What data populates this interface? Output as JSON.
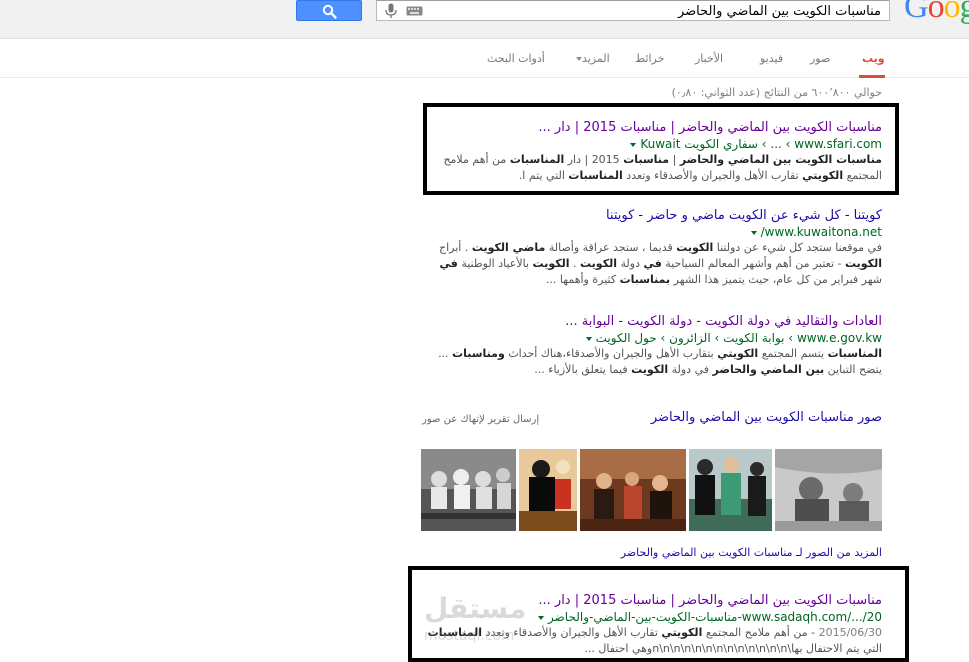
{
  "search": {
    "query": "مناسبات الكويت بين الماضي والحاضر",
    "logo_text": "Goog"
  },
  "tabs": [
    {
      "label": "ويب",
      "active": true
    },
    {
      "label": "صور"
    },
    {
      "label": "فيديو"
    },
    {
      "label": "الأخبار"
    },
    {
      "label": "خرائط"
    },
    {
      "label": "المزيد"
    },
    {
      "label": "أدوات البحث"
    }
  ],
  "stats": "حوالي ٦٠٠٬٨٠٠ من النتائج (عدد الثواني: ٠٫٨٠)",
  "results": [
    {
      "title": "مناسبات الكويت بين الماضي والحاضر | مناسبات 2015 | دار ...",
      "url": "www.sfari.com",
      "crumb": "› ... › سفاري الكويت Kuwait",
      "snippet": [
        {
          "b": "مناسبات الكويت بين الماضي والحاضر"
        },
        {
          "t": " | "
        },
        {
          "b": "مناسبات"
        },
        {
          "t": " 2015 | دار "
        },
        {
          "b": "المناسبات"
        },
        {
          "t": " من أهم ملامح المجتمع "
        },
        {
          "b": "الكويتي"
        },
        {
          "t": " تقارب الأهل والجيران والأصدقاء وتعدد "
        },
        {
          "b": "المناسبات"
        },
        {
          "t": " التي يتم ا."
        }
      ]
    },
    {
      "title": "كويتنا - كل شيء عن الكويت ماضي و حاضر - كويتنا",
      "url": "www.kuwaitona.net/",
      "snippet": [
        {
          "t": "في موقعنا ستجد كل شيء عن دولتنا "
        },
        {
          "b": "الكويت"
        },
        {
          "t": " قديما ، ستجد عراقة وأصالة "
        },
        {
          "b": "ماضي الكويت"
        },
        {
          "t": " . أبراج "
        },
        {
          "b": "الكويت"
        },
        {
          "t": " - تعتبر من أهم وأشهر المعالم السياحية "
        },
        {
          "b": "في"
        },
        {
          "t": " دولة "
        },
        {
          "b": "الكويت"
        },
        {
          "t": " . "
        },
        {
          "b": "الكويت"
        },
        {
          "t": " بالأعياد الوطنية "
        },
        {
          "b": "في"
        },
        {
          "t": " شهر فبراير من كل عام، حيث يتميز هذا الشهر "
        },
        {
          "b": "بمناسبات"
        },
        {
          "t": " كثيرة وأهمها ..."
        }
      ]
    },
    {
      "title": "العادات والتقاليد في دولة الكويت - دولة الكويت - البوابة ...",
      "url": "www.e.gov.kw",
      "crumb": "› بوابة الكويت › الزائرون › حول الكويت",
      "snippet": [
        {
          "b": "المناسبات"
        },
        {
          "t": " يتسم المجتمع "
        },
        {
          "b": "الكويتي"
        },
        {
          "t": " بتقارب الأهل والجيران والأصدقاء،هناك أحداث "
        },
        {
          "b": "ومناسبات"
        },
        {
          "t": " ... يتضح التباين "
        },
        {
          "b": "بين الماضي والحاضر"
        },
        {
          "t": " في دولة "
        },
        {
          "b": "الكويت"
        },
        {
          "t": " فيما يتعلق بالأزياء ..."
        }
      ]
    },
    {
      "title": "مناسبات الكويت بين الماضي والحاضر | مناسبات 2015 | دار ...",
      "url": "www.sadaqh.com/.../20-مناسبات-الكويت-بين-الماضي-والحاضر",
      "date": "2015/06/30",
      "snippet": [
        {
          "t": " - من أهم ملامح المجتمع "
        },
        {
          "b": "الكويتي"
        },
        {
          "t": " تقارب الأهل والجيران والأصدقاء وتعدد "
        },
        {
          "b": "المناسبات"
        },
        {
          "t": " التي يتم الاحتفال بها\\n\\n\\n\\n\\n\\n\\n\\n\\n\\n\\n\\n\\nوهي احتفال ..."
        }
      ]
    }
  ],
  "images": {
    "heading": "صور مناسبات الكويت بين الماضي والحاضر",
    "report": "إرسال تقرير لإتهاك عن صور",
    "more": "المزيد من الصور لـ مناسبات الكويت بين الماضي والحاضر"
  },
  "watermark": {
    "main": "مستقل",
    "sub": "mostaql.com"
  },
  "colors": {
    "link_visited": "#660099",
    "url_green": "#006621",
    "active_tab": "#dd4b39",
    "search_blue": "#4d90fe"
  }
}
